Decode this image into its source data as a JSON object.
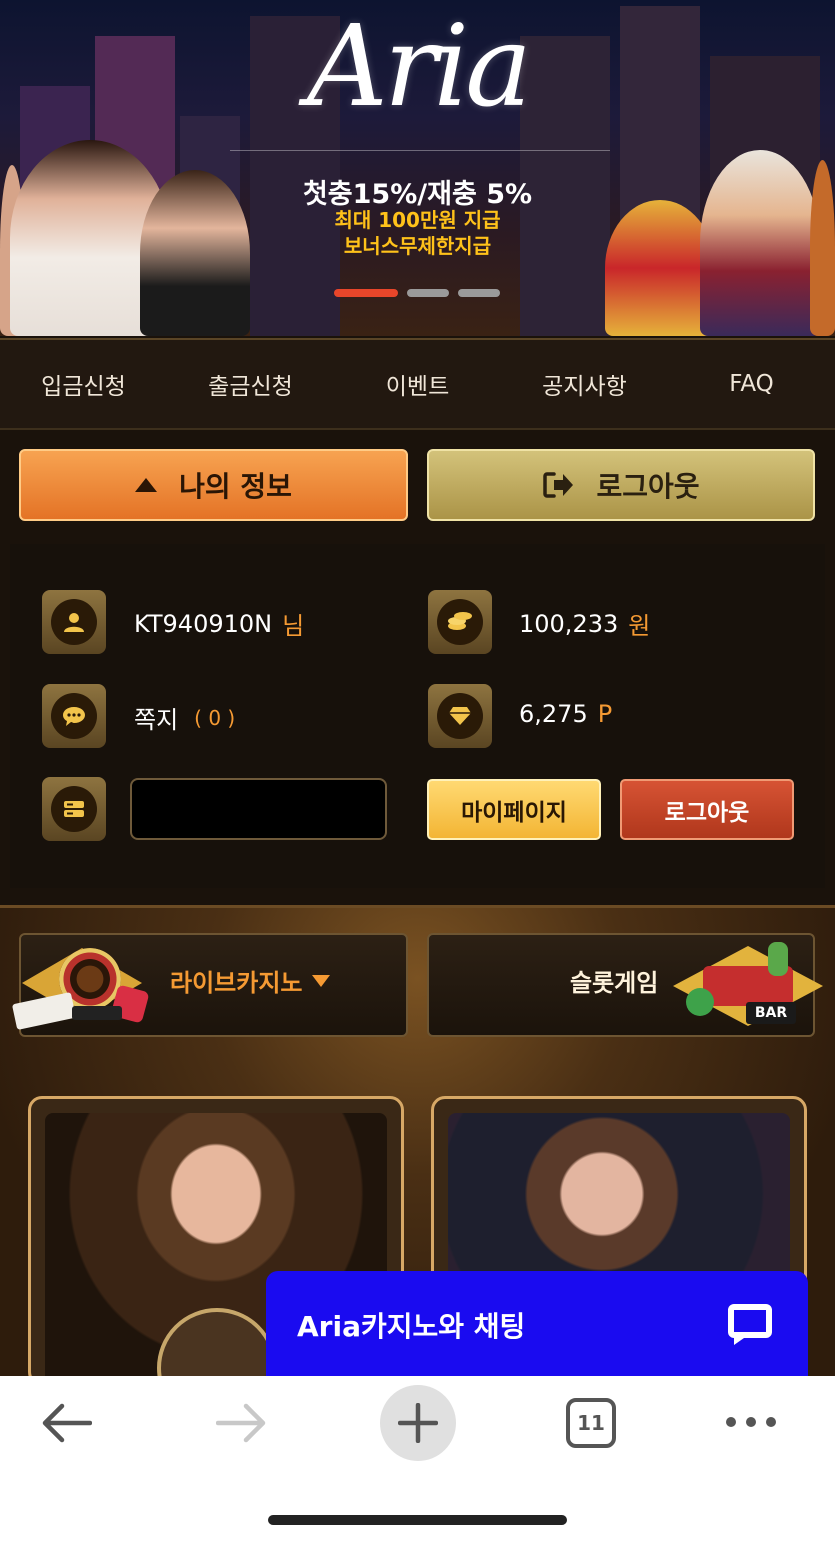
{
  "banner": {
    "logo": "Aria",
    "promo_line1": "첫충15%/재충 5%",
    "promo_line2": "최대 100만원 지급",
    "promo_line3": "보너스무제한지급",
    "slide_indicator": {
      "active": 1,
      "total": 3
    }
  },
  "nav": {
    "items": [
      {
        "label": "입금신청"
      },
      {
        "label": "출금신청"
      },
      {
        "label": "이벤트"
      },
      {
        "label": "공지사항"
      },
      {
        "label": "FAQ"
      }
    ]
  },
  "account_buttons": {
    "my_info": "나의 정보",
    "logout": "로그아웃"
  },
  "user_panel": {
    "username": "KT940910N",
    "username_suffix": "님",
    "balance": "100,233",
    "balance_unit": "원",
    "messages_label": "쪽지",
    "messages_count": "( 0 )",
    "points": "6,275",
    "points_unit": "P",
    "mypage_button": "마이페이지",
    "logout_button": "로그아웃"
  },
  "game_tabs": {
    "live_casino": "라이브카지노",
    "slot_game": "슬롯게임"
  },
  "chat_widget": {
    "title": "Aria카지노와 채팅"
  },
  "browser_bar": {
    "tab_count": "11"
  },
  "colors": {
    "accent_orange": "#f59a33",
    "chat_blue": "#1a0bf0",
    "gold": "#d7a866"
  },
  "icons": [
    "user-icon",
    "coins-icon",
    "message-icon",
    "diamond-icon",
    "wallet-icon",
    "logout-icon",
    "caret-up-icon",
    "chat-bubble-icon"
  ]
}
